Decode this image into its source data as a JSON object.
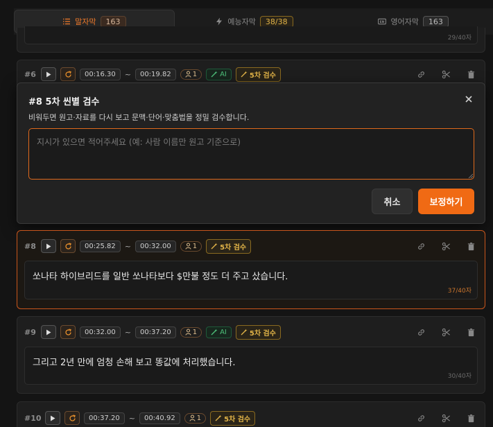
{
  "tabs": [
    {
      "label": "말자막",
      "count": "163"
    },
    {
      "label": "예능자막",
      "count": "38/38"
    },
    {
      "label": "영어자막",
      "count": "163"
    }
  ],
  "topCard": {
    "chars": "29/40자"
  },
  "cards": {
    "c6": {
      "num": "#6",
      "start": "00:16.30",
      "tilde": "~",
      "end": "00:19.82",
      "speaker": "1",
      "ai": "AI",
      "review": "5차 검수"
    },
    "c8": {
      "num": "#8",
      "start": "00:25.82",
      "tilde": "~",
      "end": "00:32.00",
      "speaker": "1",
      "review": "5차 검수",
      "text": "쏘나타 하이브리드를 일반 쏘나타보다 $만불 정도 더 주고 샀습니다.",
      "chars": "37/40자"
    },
    "c9": {
      "num": "#9",
      "start": "00:32.00",
      "tilde": "~",
      "end": "00:37.20",
      "speaker": "1",
      "ai": "AI",
      "review": "5차 검수",
      "text": "그리고 2년 만에 엄청 손해 보고 똥값에 처리했습니다.",
      "chars": "30/40자"
    },
    "c10": {
      "num": "#10",
      "start": "00:37.20",
      "tilde": "~",
      "end": "00:40.92",
      "speaker": "1",
      "review": "5차 검수"
    }
  },
  "modal": {
    "title": "#8 5차 씬별 검수",
    "description": "비워두면 원고·자료를 다시 보고 문맥·단어·맞춤법을 정밀 검수합니다.",
    "placeholder": "지시가 있으면 적어주세요 (예: 사람 이름만 원고 기준으로)",
    "value": "",
    "cancel": "취소",
    "confirm": "보정하기"
  },
  "colors": {
    "accent": "#f06a14",
    "ai": "#4ec07a",
    "review": "#e2b448"
  }
}
